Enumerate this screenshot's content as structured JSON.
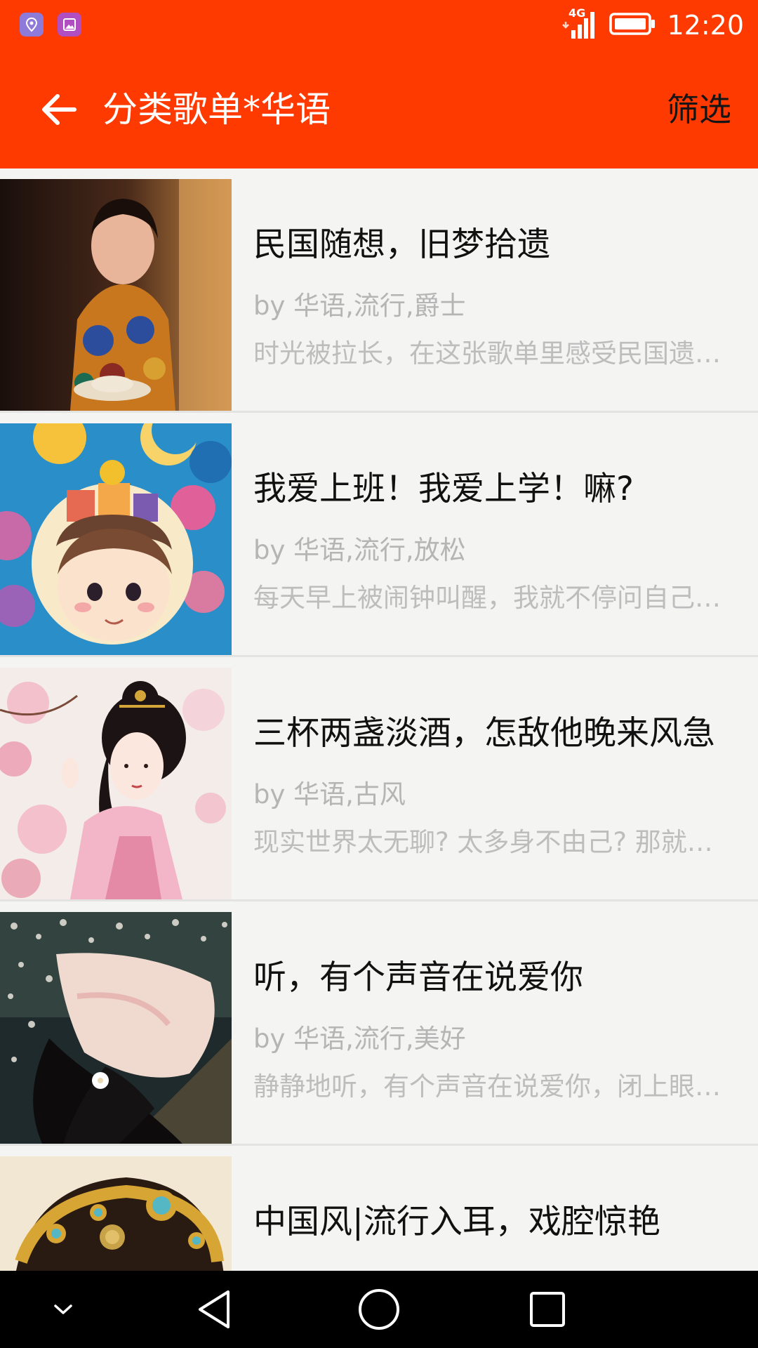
{
  "status_bar": {
    "network": "4G",
    "time": "12:20",
    "icons": [
      "map-pin-icon",
      "gallery-icon",
      "signal-icon",
      "battery-icon"
    ]
  },
  "toolbar": {
    "back_icon": "arrow-left-icon",
    "title": "分类歌单*华语",
    "filter_label": "筛选"
  },
  "playlists": [
    {
      "title": "民国随想，旧梦拾遗",
      "tags": "by 华语,流行,爵士",
      "description": "时光被拉长，在这张歌单里感受民国遗…",
      "cover": "woman-in-qipao-holding-teacup"
    },
    {
      "title": "我爱上班！我爱上学！嘛?",
      "tags": "by 华语,流行,放松",
      "description": "每天早上被闹钟叫醒，我就不停问自己…",
      "cover": "cartoon-boy-with-houses-on-head"
    },
    {
      "title": "三杯两盏淡酒，怎敌他晚来风急",
      "tags": "by 华语,古风",
      "description": "现实世界太无聊? 太多身不由己? 那就…",
      "cover": "ancient-style-painted-lady-with-blossoms"
    },
    {
      "title": "听，有个声音在说爱你",
      "tags": "by 华语,流行,美好",
      "description": "静静地听，有个声音在说爱你，闭上眼…",
      "cover": "girl-lying-in-flowers"
    },
    {
      "title": "中国风|流行入耳，戏腔惊艳",
      "tags": "",
      "description": "",
      "cover": "opera-headdress-with-jewels"
    }
  ],
  "nav_bar": {
    "icons": [
      "chevron-down-icon",
      "back-triangle-icon",
      "home-circle-icon",
      "recents-square-icon"
    ]
  },
  "colors": {
    "accent": "#ff3a00",
    "background": "#f4f4f2",
    "title_text": "#111111",
    "meta_text": "#b5b5b5"
  }
}
